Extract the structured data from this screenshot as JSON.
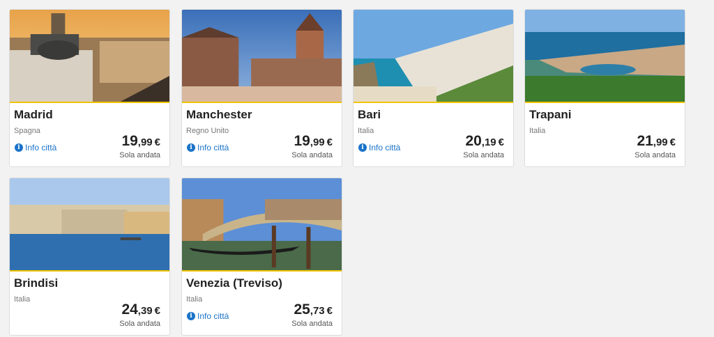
{
  "info_label": "Info città",
  "trip_label": "Sola andata",
  "currency": "€",
  "accent_color": "#f1c400",
  "cards": [
    {
      "city": "Madrid",
      "country": "Spagna",
      "price_int": "19",
      "price_dec": ",99",
      "info": true,
      "image": "madrid-photo"
    },
    {
      "city": "Manchester",
      "country": "Regno Unito",
      "price_int": "19",
      "price_dec": ",99",
      "info": true,
      "image": "manchester-photo"
    },
    {
      "city": "Bari",
      "country": "Italia",
      "price_int": "20",
      "price_dec": ",19",
      "info": true,
      "image": "bari-photo"
    },
    {
      "city": "Trapani",
      "country": "Italia",
      "price_int": "21",
      "price_dec": ",99",
      "info": false,
      "image": "trapani-photo"
    },
    {
      "city": "Brindisi",
      "country": "Italia",
      "price_int": "24",
      "price_dec": ",39",
      "info": false,
      "image": "brindisi-photo"
    },
    {
      "city": "Venezia (Treviso)",
      "country": "Italia",
      "price_int": "25",
      "price_dec": ",73",
      "info": true,
      "image": "venezia-photo"
    }
  ]
}
